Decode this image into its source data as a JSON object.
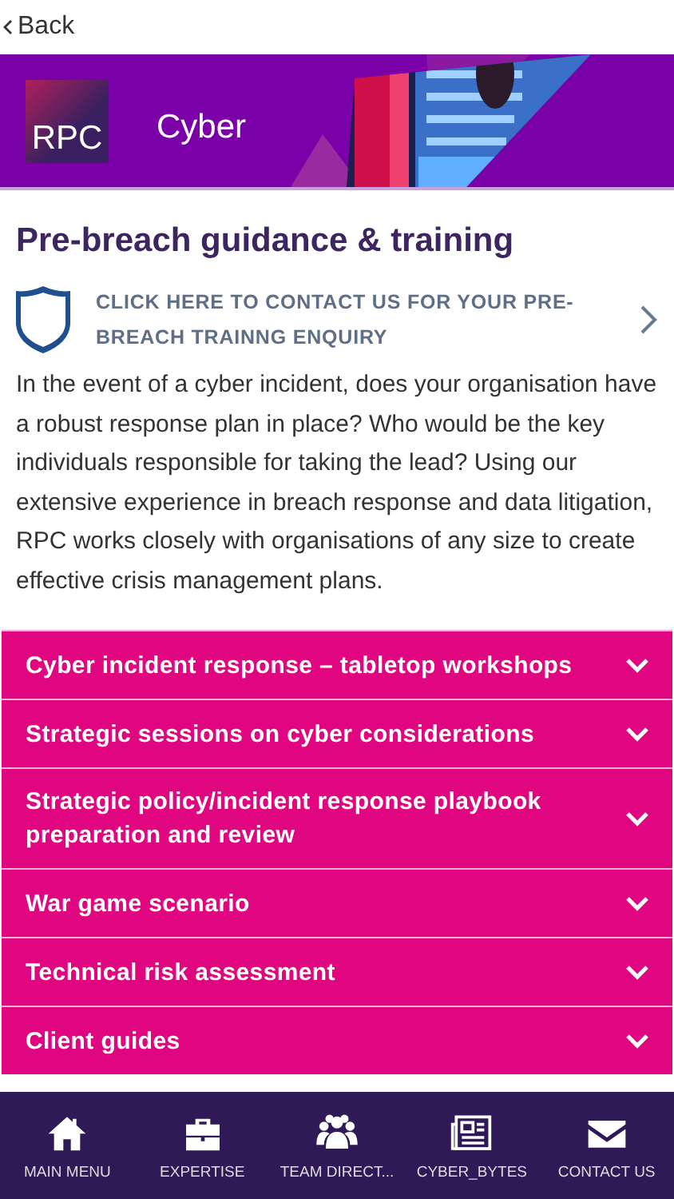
{
  "nav": {
    "back": "Back"
  },
  "banner": {
    "logo": "RPC",
    "title": "Cyber"
  },
  "heading": "Pre-breach guidance & training",
  "contact_link": {
    "text": "CLICK HERE TO CONTACT US FOR YOUR PRE-BREACH TRAINNG ENQUIRY"
  },
  "intro": "In the event of a cyber incident, does your organisation have a robust response plan in place? Who would be the key individuals responsible for taking the lead? Using our extensive experience in breach response and data litigation, RPC works closely with organisations of any size to create effective crisis management plans.",
  "sections": [
    {
      "title": "Cyber incident response – tabletop workshops",
      "expanded": false
    },
    {
      "title": "Strategic sessions on cyber considerations",
      "expanded": false
    },
    {
      "title": "Strategic policy/incident response playbook preparation and review",
      "expanded": false
    },
    {
      "title": "War game scenario",
      "expanded": false
    },
    {
      "title": "Technical risk assessment",
      "expanded": false
    },
    {
      "title": "Client guides",
      "expanded": false
    }
  ],
  "tab_bar": [
    {
      "kind": "home",
      "label": "MAIN MENU"
    },
    {
      "kind": "briefcase",
      "label": "EXPERTISE"
    },
    {
      "kind": "people",
      "label": "TEAM DIRECT..."
    },
    {
      "kind": "news",
      "label": "CYBER_BYTES"
    },
    {
      "kind": "mail",
      "label": "CONTACT US"
    }
  ]
}
